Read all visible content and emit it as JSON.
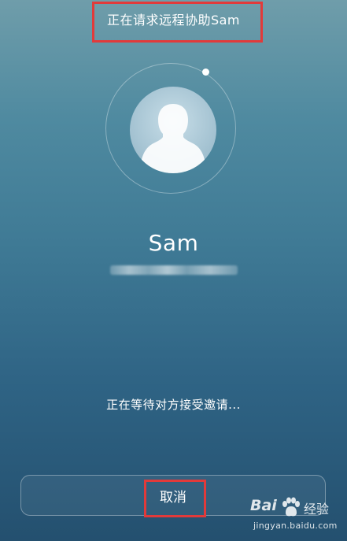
{
  "header": {
    "title": "正在请求远程协助Sam"
  },
  "contact": {
    "name": "Sam",
    "avatar_icon": "person-silhouette-icon"
  },
  "status": {
    "waiting_text": "正在等待对方接受邀请..."
  },
  "actions": {
    "cancel_label": "取消"
  },
  "watermark": {
    "logo_text": "Bai",
    "brand_text": "经验",
    "url": "jingyan.baidu.com"
  },
  "colors": {
    "highlight": "#e23a3a",
    "text": "#ffffff"
  }
}
